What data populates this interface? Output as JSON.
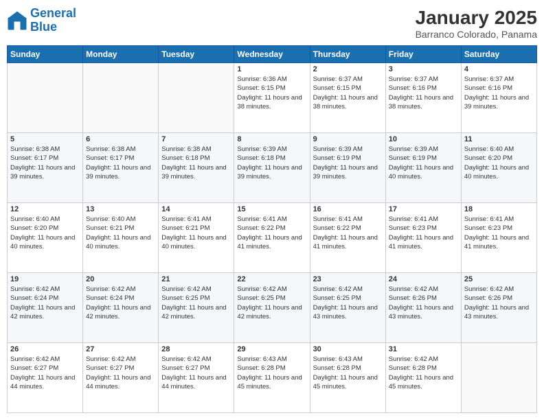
{
  "header": {
    "logo_line1": "General",
    "logo_line2": "Blue",
    "month_title": "January 2025",
    "location": "Barranco Colorado, Panama"
  },
  "days_of_week": [
    "Sunday",
    "Monday",
    "Tuesday",
    "Wednesday",
    "Thursday",
    "Friday",
    "Saturday"
  ],
  "weeks": [
    [
      {
        "day": "",
        "info": ""
      },
      {
        "day": "",
        "info": ""
      },
      {
        "day": "",
        "info": ""
      },
      {
        "day": "1",
        "info": "Sunrise: 6:36 AM\nSunset: 6:15 PM\nDaylight: 11 hours and 38 minutes."
      },
      {
        "day": "2",
        "info": "Sunrise: 6:37 AM\nSunset: 6:15 PM\nDaylight: 11 hours and 38 minutes."
      },
      {
        "day": "3",
        "info": "Sunrise: 6:37 AM\nSunset: 6:16 PM\nDaylight: 11 hours and 38 minutes."
      },
      {
        "day": "4",
        "info": "Sunrise: 6:37 AM\nSunset: 6:16 PM\nDaylight: 11 hours and 39 minutes."
      }
    ],
    [
      {
        "day": "5",
        "info": "Sunrise: 6:38 AM\nSunset: 6:17 PM\nDaylight: 11 hours and 39 minutes."
      },
      {
        "day": "6",
        "info": "Sunrise: 6:38 AM\nSunset: 6:17 PM\nDaylight: 11 hours and 39 minutes."
      },
      {
        "day": "7",
        "info": "Sunrise: 6:38 AM\nSunset: 6:18 PM\nDaylight: 11 hours and 39 minutes."
      },
      {
        "day": "8",
        "info": "Sunrise: 6:39 AM\nSunset: 6:18 PM\nDaylight: 11 hours and 39 minutes."
      },
      {
        "day": "9",
        "info": "Sunrise: 6:39 AM\nSunset: 6:19 PM\nDaylight: 11 hours and 39 minutes."
      },
      {
        "day": "10",
        "info": "Sunrise: 6:39 AM\nSunset: 6:19 PM\nDaylight: 11 hours and 40 minutes."
      },
      {
        "day": "11",
        "info": "Sunrise: 6:40 AM\nSunset: 6:20 PM\nDaylight: 11 hours and 40 minutes."
      }
    ],
    [
      {
        "day": "12",
        "info": "Sunrise: 6:40 AM\nSunset: 6:20 PM\nDaylight: 11 hours and 40 minutes."
      },
      {
        "day": "13",
        "info": "Sunrise: 6:40 AM\nSunset: 6:21 PM\nDaylight: 11 hours and 40 minutes."
      },
      {
        "day": "14",
        "info": "Sunrise: 6:41 AM\nSunset: 6:21 PM\nDaylight: 11 hours and 40 minutes."
      },
      {
        "day": "15",
        "info": "Sunrise: 6:41 AM\nSunset: 6:22 PM\nDaylight: 11 hours and 41 minutes."
      },
      {
        "day": "16",
        "info": "Sunrise: 6:41 AM\nSunset: 6:22 PM\nDaylight: 11 hours and 41 minutes."
      },
      {
        "day": "17",
        "info": "Sunrise: 6:41 AM\nSunset: 6:23 PM\nDaylight: 11 hours and 41 minutes."
      },
      {
        "day": "18",
        "info": "Sunrise: 6:41 AM\nSunset: 6:23 PM\nDaylight: 11 hours and 41 minutes."
      }
    ],
    [
      {
        "day": "19",
        "info": "Sunrise: 6:42 AM\nSunset: 6:24 PM\nDaylight: 11 hours and 42 minutes."
      },
      {
        "day": "20",
        "info": "Sunrise: 6:42 AM\nSunset: 6:24 PM\nDaylight: 11 hours and 42 minutes."
      },
      {
        "day": "21",
        "info": "Sunrise: 6:42 AM\nSunset: 6:25 PM\nDaylight: 11 hours and 42 minutes."
      },
      {
        "day": "22",
        "info": "Sunrise: 6:42 AM\nSunset: 6:25 PM\nDaylight: 11 hours and 42 minutes."
      },
      {
        "day": "23",
        "info": "Sunrise: 6:42 AM\nSunset: 6:25 PM\nDaylight: 11 hours and 43 minutes."
      },
      {
        "day": "24",
        "info": "Sunrise: 6:42 AM\nSunset: 6:26 PM\nDaylight: 11 hours and 43 minutes."
      },
      {
        "day": "25",
        "info": "Sunrise: 6:42 AM\nSunset: 6:26 PM\nDaylight: 11 hours and 43 minutes."
      }
    ],
    [
      {
        "day": "26",
        "info": "Sunrise: 6:42 AM\nSunset: 6:27 PM\nDaylight: 11 hours and 44 minutes."
      },
      {
        "day": "27",
        "info": "Sunrise: 6:42 AM\nSunset: 6:27 PM\nDaylight: 11 hours and 44 minutes."
      },
      {
        "day": "28",
        "info": "Sunrise: 6:42 AM\nSunset: 6:27 PM\nDaylight: 11 hours and 44 minutes."
      },
      {
        "day": "29",
        "info": "Sunrise: 6:43 AM\nSunset: 6:28 PM\nDaylight: 11 hours and 45 minutes."
      },
      {
        "day": "30",
        "info": "Sunrise: 6:43 AM\nSunset: 6:28 PM\nDaylight: 11 hours and 45 minutes."
      },
      {
        "day": "31",
        "info": "Sunrise: 6:42 AM\nSunset: 6:28 PM\nDaylight: 11 hours and 45 minutes."
      },
      {
        "day": "",
        "info": ""
      }
    ]
  ]
}
